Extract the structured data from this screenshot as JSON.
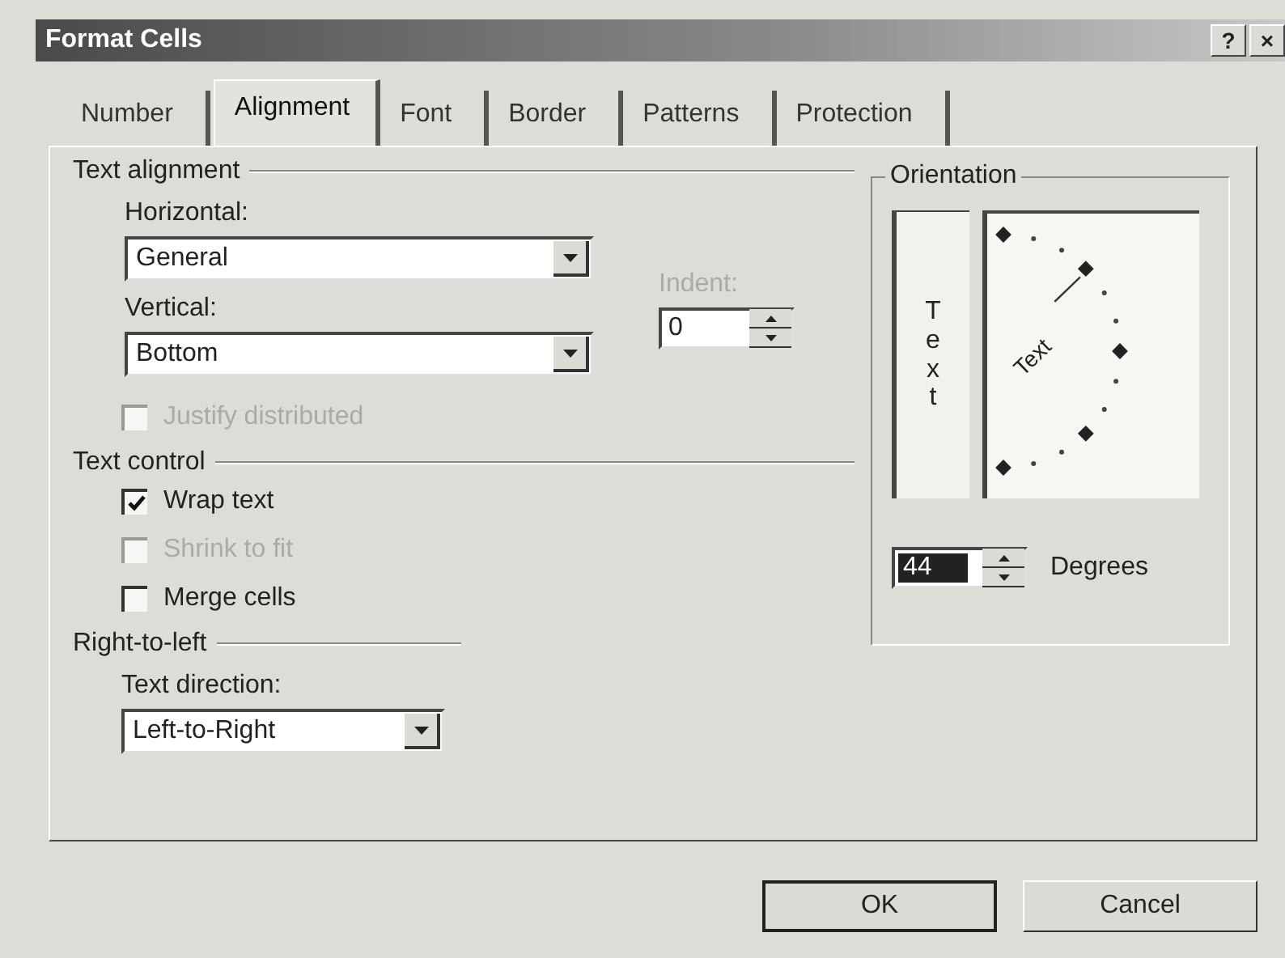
{
  "window": {
    "title": "Format Cells",
    "controls": [
      "?",
      "×"
    ]
  },
  "tabs": [
    {
      "label": "Number",
      "selected": false
    },
    {
      "label": "Alignment",
      "selected": true
    },
    {
      "label": "Font",
      "selected": false
    },
    {
      "label": "Border",
      "selected": false
    },
    {
      "label": "Patterns",
      "selected": false
    },
    {
      "label": "Protection",
      "selected": false
    }
  ],
  "text_alignment": {
    "heading": "Text alignment",
    "horizontal": {
      "label": "Horizontal:",
      "value": "General"
    },
    "vertical": {
      "label": "Vertical:",
      "value": "Bottom"
    },
    "indent": {
      "label": "Indent:",
      "value": "0"
    },
    "justify_distributed": {
      "label": "Justify distributed",
      "checked": false,
      "disabled": true
    }
  },
  "text_control": {
    "heading": "Text control",
    "options": [
      {
        "label": "Wrap text",
        "checked": true,
        "disabled": false
      },
      {
        "label": "Shrink to fit",
        "checked": false,
        "disabled": true
      },
      {
        "label": "Merge cells",
        "checked": false,
        "disabled": false
      }
    ]
  },
  "right_to_left": {
    "heading": "Right-to-left",
    "text_direction": {
      "label": "Text direction:",
      "value": "Left-to-Right"
    }
  },
  "orientation": {
    "heading": "Orientation",
    "vertical_text": "Text",
    "dial_text": "Text",
    "degrees": {
      "value": "44",
      "label": "Degrees"
    }
  },
  "buttons": [
    {
      "label": "OK",
      "default": true
    },
    {
      "label": "Cancel",
      "default": false
    }
  ]
}
